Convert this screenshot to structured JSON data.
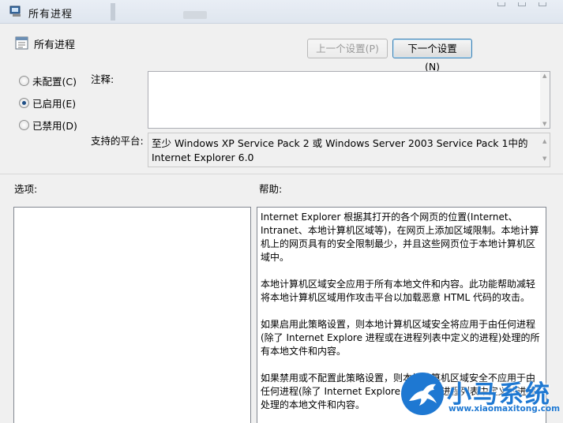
{
  "window": {
    "title": "所有进程"
  },
  "setting": {
    "name": "所有进程",
    "prev_button": "上一个设置(P)",
    "next_button": "下一个设置(N)"
  },
  "state": {
    "options": [
      {
        "label": "未配置(C)",
        "checked": false
      },
      {
        "label": "已启用(E)",
        "checked": true
      },
      {
        "label": "已禁用(D)",
        "checked": false
      }
    ]
  },
  "comment": {
    "label": "注释:",
    "value": ""
  },
  "platform": {
    "label": "支持的平台:",
    "value_line1": "至少 Windows XP Service Pack 2 或 Windows Server 2003 Service Pack 1中的",
    "value_line2": "Internet Explorer 6.0"
  },
  "options_label": "选项:",
  "help": {
    "label": "帮助:",
    "paragraphs": [
      "Internet Explorer 根据其打开的各个网页的位置(Internet、Intranet、本地计算机区域等)，在网页上添加区域限制。本地计算机上的网页具有的安全限制最少，并且这些网页位于本地计算机区域中。",
      "本地计算机区域安全应用于所有本地文件和内容。此功能帮助减轻将本地计算机区域用作攻击平台以加载恶意 HTML 代码的攻击。",
      "如果启用此策略设置，则本地计算机区域安全将应用于由任何进程(除了 Internet Explore 进程或在进程列表中定义的进程)处理的所有本地文件和内容。",
      "如果禁用或不配置此策略设置，则本地计算机区域安全不应用于由任何进程(除了 Internet Explore 进程或在进程列表中定义的进程)处理的本地文件和内容。"
    ]
  },
  "watermark": {
    "brand": "小马系统",
    "url": "www.xiaomaxitong.com",
    "color": "#1e78d2"
  }
}
